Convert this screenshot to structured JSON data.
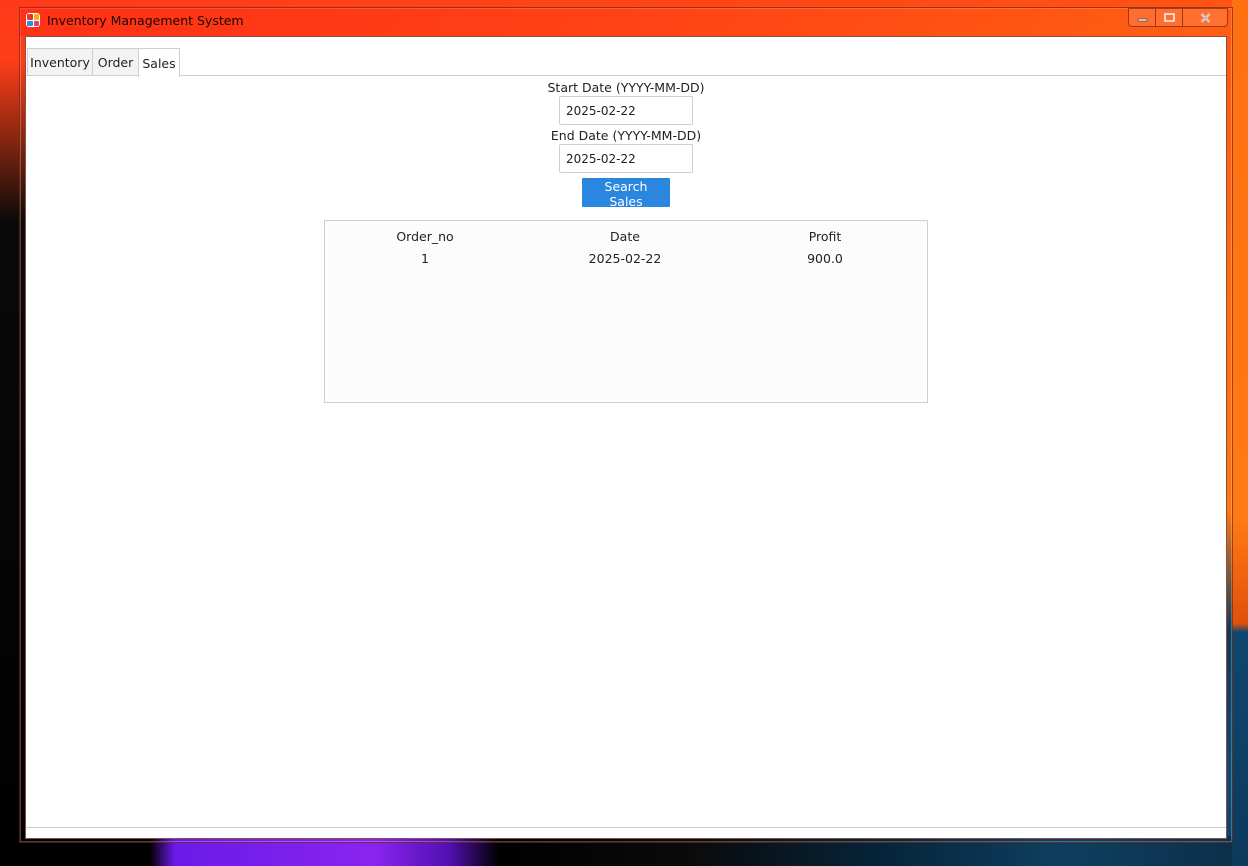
{
  "window": {
    "title": "Inventory Management System",
    "app_icon": "app-grid-icon",
    "controls": {
      "minimize_icon": "minimize-icon",
      "maximize_icon": "maximize-icon",
      "close_icon": "close-icon"
    }
  },
  "tabs": [
    {
      "label": "Inventory",
      "active": false
    },
    {
      "label": "Order",
      "active": false
    },
    {
      "label": "Sales",
      "active": true
    }
  ],
  "sales": {
    "start_label": "Start Date (YYYY-MM-DD)",
    "start_value": "2025-02-22",
    "end_label": "End Date (YYYY-MM-DD)",
    "end_value": "2025-02-22",
    "search_label": "Search Sales",
    "search_color": "#2b86e0",
    "table": {
      "columns": [
        "Order_no",
        "Date",
        "Profit"
      ],
      "rows": [
        [
          "1",
          "2025-02-22",
          "900.0"
        ]
      ]
    }
  }
}
